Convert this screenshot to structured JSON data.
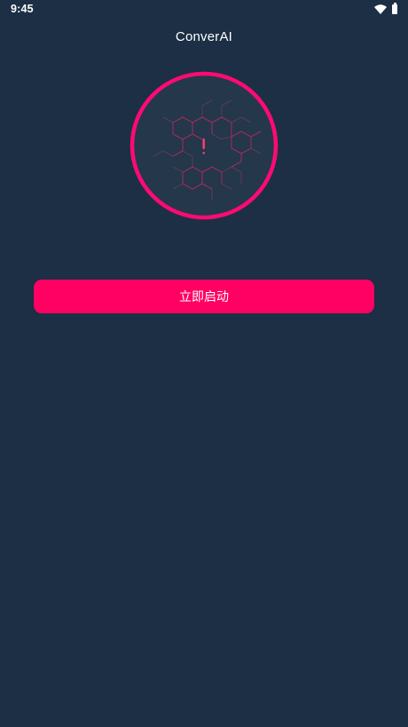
{
  "status_bar": {
    "time": "9:45",
    "icons": [
      "wifi-icon",
      "battery-icon"
    ]
  },
  "header": {
    "title": "ConverAI"
  },
  "connection_ring": {
    "icon": "alert-exclamation-icon",
    "symbol": "!",
    "state": "disconnected",
    "ring_color": "#ff0a73",
    "pattern": "hexagon-network"
  },
  "actions": {
    "start_label": "立即启动"
  },
  "colors": {
    "background": "#1c2f44",
    "accent": "#ff0063",
    "text": "#ffffff"
  }
}
